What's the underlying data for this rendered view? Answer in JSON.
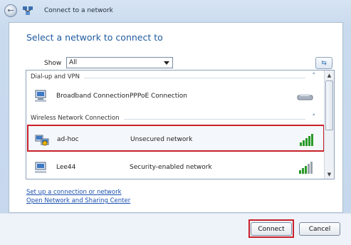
{
  "window": {
    "title": "Connect to a network"
  },
  "main": {
    "heading": "Select a network to connect to",
    "show_label": "Show",
    "show_value": "All"
  },
  "groups": [
    {
      "label": "Dial-up and VPN"
    },
    {
      "label": "Wireless Network Connection"
    }
  ],
  "networks": [
    {
      "name": "Broadband Connection",
      "status": "PPPoE Connection",
      "icon": "network-computer-icon",
      "indicator": "modem-icon",
      "selected": false
    },
    {
      "name": "ad-hoc",
      "status": "Unsecured network",
      "icon": "adhoc-network-icon",
      "indicator": "signal-bars-icon",
      "signal_bars": 5,
      "selected": true
    },
    {
      "name": "Lee44",
      "status": "Security-enabled network",
      "icon": "wireless-network-icon",
      "indicator": "signal-bars-icon",
      "signal_bars": 5,
      "selected": false
    }
  ],
  "links": [
    {
      "label": "Set up a connection or network"
    },
    {
      "label": "Open Network and Sharing Center"
    }
  ],
  "buttons": {
    "connect": "Connect",
    "cancel": "Cancel"
  },
  "colors": {
    "accent": "#1f5a9e",
    "highlight": "#c8202a",
    "signal": "#2a9a2a"
  }
}
